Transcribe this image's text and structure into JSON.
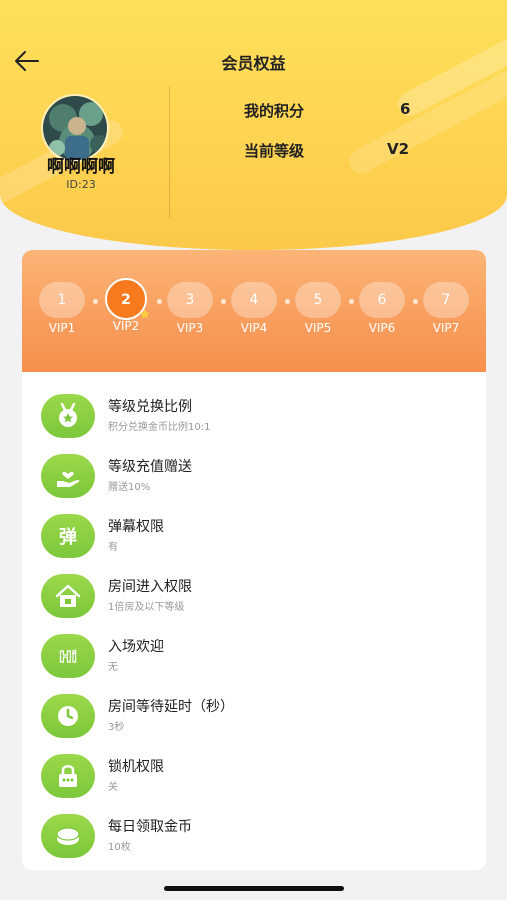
{
  "header": {
    "title": "会员权益",
    "back_icon": "back-arrow-icon",
    "user": {
      "name": "啊啊啊啊",
      "id": "ID:23"
    },
    "stats": [
      {
        "label": "我的积分",
        "value": "6"
      },
      {
        "label": "当前等级",
        "value": "V2"
      }
    ]
  },
  "vip_levels": {
    "current_index": 1,
    "items": [
      {
        "num": "1",
        "label": "VIP1"
      },
      {
        "num": "2",
        "label": "VIP2"
      },
      {
        "num": "3",
        "label": "VIP3"
      },
      {
        "num": "4",
        "label": "VIP4"
      },
      {
        "num": "5",
        "label": "VIP5"
      },
      {
        "num": "6",
        "label": "VIP6"
      },
      {
        "num": "7",
        "label": "VIP7"
      }
    ]
  },
  "benefits": [
    {
      "icon": "medal-icon",
      "title": "等级兑换比例",
      "desc": "积分兑换金币比例10:1"
    },
    {
      "icon": "gift-hand-icon",
      "title": "等级充值赠送",
      "desc": "赠送10%"
    },
    {
      "icon": "danmu-icon",
      "title": "弹幕权限",
      "desc": "有"
    },
    {
      "icon": "house-icon",
      "title": "房间进入权限",
      "desc": "1倍房及以下等级"
    },
    {
      "icon": "hi-icon",
      "title": "入场欢迎",
      "desc": "无"
    },
    {
      "icon": "clock-icon",
      "title": "房间等待延时（秒）",
      "desc": "3秒"
    },
    {
      "icon": "lock-icon",
      "title": "锁机权限",
      "desc": "关"
    },
    {
      "icon": "coin-icon",
      "title": "每日领取金币",
      "desc": "10枚"
    }
  ],
  "colors": {
    "header_yellow": "#fed553",
    "card_orange": "#f9a060",
    "active_vip": "#f77a1f",
    "icon_green": "#86cd3f"
  }
}
